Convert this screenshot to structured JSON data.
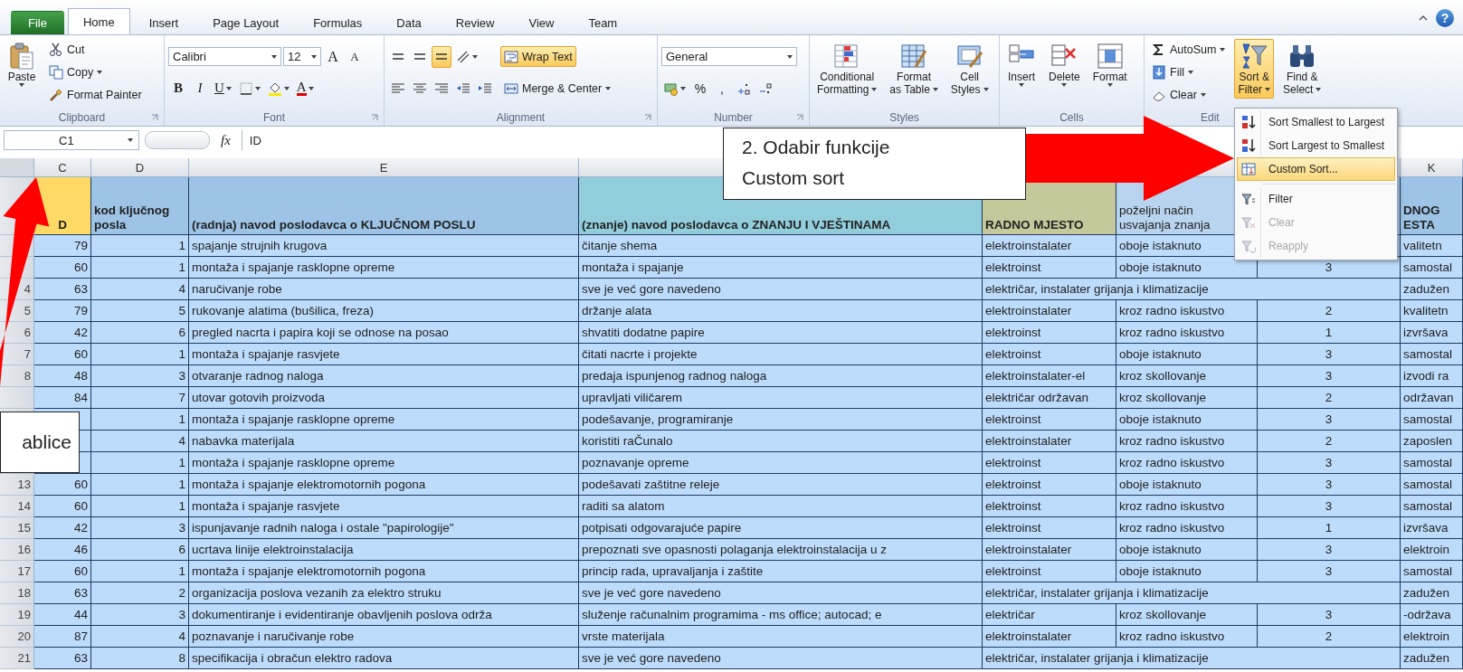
{
  "ribbon": {
    "tabs": [
      {
        "label": "File",
        "kind": "file",
        "selected": false
      },
      {
        "label": "Home",
        "kind": "tab",
        "selected": true
      },
      {
        "label": "Insert",
        "kind": "tab",
        "selected": false
      },
      {
        "label": "Page Layout",
        "kind": "tab",
        "selected": false
      },
      {
        "label": "Formulas",
        "kind": "tab",
        "selected": false
      },
      {
        "label": "Data",
        "kind": "tab",
        "selected": false
      },
      {
        "label": "Review",
        "kind": "tab",
        "selected": false
      },
      {
        "label": "View",
        "kind": "tab",
        "selected": false
      },
      {
        "label": "Team",
        "kind": "tab",
        "selected": false
      }
    ],
    "help": "?",
    "groups": [
      {
        "label": "Clipboard",
        "launcher": true,
        "items": [
          {
            "kind": "large",
            "lines": [
              "Paste"
            ],
            "caret": true
          },
          {
            "kind": "stack",
            "rows": [
              {
                "controls": [
                  {
                    "kind": "small",
                    "label": "Cut"
                  }
                ]
              },
              {
                "controls": [
                  {
                    "kind": "small",
                    "label": "Copy",
                    "caret": true
                  }
                ]
              },
              {
                "controls": [
                  {
                    "kind": "small",
                    "label": "Format Painter"
                  }
                ]
              }
            ]
          }
        ]
      },
      {
        "label": "Font",
        "launcher": true,
        "items": [
          {
            "kind": "stack",
            "rows": [
              {
                "controls": [
                  {
                    "kind": "fontbox",
                    "value": "Calibri"
                  },
                  {
                    "kind": "sizebox",
                    "value": "12"
                  },
                  {
                    "kind": "grow",
                    "text": "A"
                  },
                  {
                    "kind": "shrink",
                    "text": "A"
                  }
                ]
              },
              {
                "controls": [
                  {
                    "kind": "bold",
                    "text": "B"
                  },
                  {
                    "kind": "italic",
                    "text": "I"
                  },
                  {
                    "kind": "underline",
                    "text": "U",
                    "caret": true
                  },
                  {
                    "kind": "icon",
                    "caret": true
                  },
                  {
                    "kind": "icon",
                    "caret": true
                  },
                  {
                    "kind": "fontcolor",
                    "text": "A",
                    "caret": true
                  }
                ]
              }
            ]
          }
        ]
      },
      {
        "label": "Alignment",
        "launcher": true,
        "items": [
          {
            "kind": "stack",
            "rows": [
              {
                "controls": [
                  {
                    "kind": "icon",
                    "on": false
                  },
                  {
                    "kind": "icon",
                    "on": false
                  },
                  {
                    "kind": "icon",
                    "on": true
                  },
                  {
                    "kind": "icon",
                    "caret": true
                  }
                ]
              },
              {
                "controls": [
                  {
                    "kind": "icon",
                    "on": false
                  },
                  {
                    "kind": "icon",
                    "on": false
                  },
                  {
                    "kind": "icon",
                    "on": false
                  },
                  {
                    "kind": "icon"
                  },
                  {
                    "kind": "icon"
                  }
                ]
              }
            ]
          },
          {
            "kind": "stack",
            "rows": [
              {
                "controls": [
                  {
                    "kind": "small",
                    "label": "Wrap Text",
                    "on": true
                  }
                ]
              },
              {
                "controls": [
                  {
                    "kind": "small",
                    "label": "Merge & Center",
                    "caret": true,
                    "on": false
                  }
                ]
              }
            ]
          }
        ]
      },
      {
        "label": "Number",
        "launcher": true,
        "items": [
          {
            "kind": "stack",
            "rows": [
              {
                "controls": [
                  {
                    "kind": "formatbox",
                    "value": "General"
                  }
                ]
              },
              {
                "controls": [
                  {
                    "kind": "icon",
                    "caret": true
                  },
                  {
                    "kind": "symbol",
                    "text": "%"
                  },
                  {
                    "kind": "symbol",
                    "text": ","
                  },
                  {
                    "kind": "icon"
                  },
                  {
                    "kind": "icon"
                  }
                ]
              }
            ]
          }
        ]
      },
      {
        "label": "Styles",
        "items": [
          {
            "kind": "large",
            "lines": [
              "Conditional",
              "Formatting"
            ],
            "caret": true
          },
          {
            "kind": "large",
            "lines": [
              "Format",
              "as Table"
            ],
            "caret": true
          },
          {
            "kind": "large",
            "lines": [
              "Cell",
              "Styles"
            ],
            "caret": true
          }
        ]
      },
      {
        "label": "Cells",
        "items": [
          {
            "kind": "large",
            "lines": [
              "Insert"
            ],
            "caret": true
          },
          {
            "kind": "large",
            "lines": [
              "Delete"
            ],
            "caret": true
          },
          {
            "kind": "large",
            "lines": [
              "Format"
            ],
            "caret": true
          }
        ]
      },
      {
        "label": "Edit",
        "items": [
          {
            "kind": "stack",
            "rows": [
              {
                "controls": [
                  {
                    "kind": "small",
                    "label": "AutoSum",
                    "caret": true
                  }
                ]
              },
              {
                "controls": [
                  {
                    "kind": "small",
                    "label": "Fill",
                    "caret": true
                  }
                ]
              },
              {
                "controls": [
                  {
                    "kind": "small",
                    "label": "Clear",
                    "caret": true
                  }
                ]
              }
            ]
          },
          {
            "kind": "large",
            "lines": [
              "Sort &",
              "Filter"
            ],
            "caret": true,
            "on": true
          },
          {
            "kind": "large",
            "lines": [
              "Find &",
              "Select"
            ],
            "caret": true,
            "on": false
          }
        ]
      }
    ]
  },
  "formula_bar": {
    "name_box": "C1",
    "fx": "fx",
    "formula": "ID"
  },
  "sheet": {
    "columns": [
      "C",
      "D",
      "E",
      "K"
    ],
    "header_row": [
      {
        "text": "D",
        "color": "#ffd966",
        "bold": true
      },
      {
        "text": "kod ključnog posla",
        "color": "#9dc3e6",
        "bold": true
      },
      {
        "text": "(radnja) navod poslodavca o KLJUČNOM POSLU",
        "color": "#9dc3e6",
        "bold": true
      },
      {
        "text": "(znanje) navod poslodavca o ZNANJU I VJEŠTINAMA",
        "color": "#92cddc",
        "bold": true
      },
      {
        "text": "RADNO MJESTO",
        "color": "#c4c89b",
        "bold": true
      },
      {
        "text": "poželjni način usvajanja znanja",
        "color": "#b8d4ee",
        "bold": false
      },
      {
        "text": "DNOG ESTA",
        "color": "#9dc3e6",
        "bold": true
      }
    ],
    "rows": [
      {
        "kind": "normal",
        "c": "79",
        "d": "1",
        "e": "spajanje strujnih krugova",
        "f": "čitanje shema",
        "g": "elektroinstalater",
        "h": "oboje istaknuto",
        "k": "valitetn"
      },
      {
        "kind": "normal",
        "c": "60",
        "d": "1",
        "e": "montaža i spajanje rasklopne opreme",
        "f": "montaža i spajanje",
        "g": "elektroinst",
        "h": "oboje istaknuto",
        "i": "3",
        "k": "samostal"
      },
      {
        "kind": "overflow",
        "num": "4",
        "c": "63",
        "d": "4",
        "e": "naručivanje robe",
        "f": "sve je već gore navedeno",
        "g": "električar, instalater grijanja i klimatizacije",
        "k": "zadužen"
      },
      {
        "kind": "normal",
        "num": "5",
        "c": "79",
        "d": "5",
        "e": "rukovanje alatima (bušilica, freza)",
        "f": "držanje alata",
        "g": "elektroinstalater",
        "h": "kroz radno iskustvo",
        "i": "2",
        "k": "kvalitetn"
      },
      {
        "kind": "normal",
        "num": "6",
        "c": "42",
        "d": "6",
        "e": "pregled nacrta i papira koji se odnose na posao",
        "f": "shvatiti dodatne papire",
        "g": "elektroinst",
        "h": "kroz radno iskustvo",
        "i": "1",
        "k": "izvršava"
      },
      {
        "kind": "normal",
        "num": "7",
        "c": "60",
        "d": "1",
        "e": "montaža i spajanje rasvjete",
        "f": "čitati nacrte i projekte",
        "g": "elektroinst",
        "h": "oboje istaknuto",
        "i": "3",
        "k": "samostal"
      },
      {
        "kind": "normal",
        "num": "8",
        "c": "48",
        "d": "3",
        "e": "otvaranje radnog naloga",
        "f": "predaja ispunjenog radnog naloga",
        "g": "elektroinstalater-el",
        "h": "kroz skollovanje",
        "i": "3",
        "k": "izvodi ra"
      },
      {
        "kind": "normal",
        "c": "84",
        "d": "7",
        "e": "utovar gotovih proizvoda",
        "f": "upravljati viličarem",
        "g": "električar održavan",
        "h": "kroz skollovanje",
        "i": "2",
        "k": "održavan"
      },
      {
        "kind": "normal",
        "d": "1",
        "e": "montaža i spajanje rasklopne opreme",
        "f": "podešavanje, programiranje",
        "g": "elektroinst",
        "h": "oboje istaknuto",
        "i": "3",
        "k": "samostal"
      },
      {
        "kind": "normal",
        "d": "4",
        "e": "nabavka materijala",
        "f": "koristiti raČunalo",
        "g": "elektroinstalater",
        "h": "kroz radno iskustvo",
        "i": "2",
        "k": "zaposlen"
      },
      {
        "kind": "normal",
        "d": "1",
        "e": "montaža i spajanje rasklopne opreme",
        "f": "poznavanje opreme",
        "g": "elektroinst",
        "h": "kroz radno iskustvo",
        "i": "3",
        "k": "samostal"
      },
      {
        "kind": "normal",
        "num": "13",
        "c": "60",
        "d": "1",
        "e": "montaža i spajanje elektromotornih pogona",
        "f": "podešavati zaštitne releje",
        "g": "elektroinst",
        "h": "oboje istaknuto",
        "i": "3",
        "k": "samostal"
      },
      {
        "kind": "normal",
        "num": "14",
        "c": "60",
        "d": "1",
        "e": "montaža i spajanje rasvjete",
        "f": "raditi sa alatom",
        "g": "elektroinst",
        "h": "kroz radno iskustvo",
        "i": "3",
        "k": "samostal"
      },
      {
        "kind": "normal",
        "num": "15",
        "c": "42",
        "d": "3",
        "e": "ispunjavanje radnih naloga i ostale \"papirologije\"",
        "f": "potpisati odgovarajuće papire",
        "g": "elektroinst",
        "h": "kroz radno iskustvo",
        "i": "1",
        "k": "izvršava"
      },
      {
        "kind": "normal",
        "num": "16",
        "c": "46",
        "d": "6",
        "e": "ucrtava linije elektroinstalacija",
        "f": "prepoznati sve opasnosti polaganja elektroinstalacija u z",
        "g": "elektroinstalater",
        "h": "oboje istaknuto",
        "i": "3",
        "k": "elektroin"
      },
      {
        "kind": "normal",
        "num": "17",
        "c": "60",
        "d": "1",
        "e": "montaža i spajanje elektromotornih pogona",
        "f": "princip rada, upravaljanja i zaštite",
        "g": "elektroinst",
        "h": "oboje istaknuto",
        "i": "3",
        "k": "samostal"
      },
      {
        "kind": "overflow",
        "num": "18",
        "c": "63",
        "d": "2",
        "e": "organizacija poslova vezanih za elektro struku",
        "f": "sve je već gore navedeno",
        "g": "električar, instalater grijanja i klimatizacije",
        "k": "zadužen"
      },
      {
        "kind": "normal",
        "num": "19",
        "c": "44",
        "d": "3",
        "e": "dokumentiranje i evidentiranje obavljenih poslova održa",
        "f": "služenje računalnim programima - ms office; autocad; e",
        "g": "električar",
        "h": "kroz skollovanje",
        "i": "3",
        "k": "-održava"
      },
      {
        "kind": "normal",
        "num": "20",
        "c": "87",
        "d": "4",
        "e": "poznavanje i naručivanje robe",
        "f": "vrste materijala",
        "g": "elektroinstalater",
        "h": "kroz radno iskustvo",
        "i": "2",
        "k": "elektroin"
      },
      {
        "kind": "overflow",
        "num": "21",
        "c": "63",
        "d": "8",
        "e": "specifikacija i obračun elektro radova",
        "f": "sve je već gore navedeno",
        "g": "električar, instalater grijanja i klimatizacije",
        "k": "zadužen"
      }
    ]
  },
  "sort_menu": {
    "sections": [
      [
        {
          "label": "Sort Smallest to Largest",
          "selected": false,
          "disabled": false
        },
        {
          "label": "Sort Largest to Smallest",
          "selected": false,
          "disabled": false
        },
        {
          "label": "Custom Sort...",
          "selected": true,
          "disabled": false
        }
      ],
      [
        {
          "label": "Filter",
          "selected": false,
          "disabled": false
        },
        {
          "label": "Clear",
          "selected": false,
          "disabled": true
        },
        {
          "label": "Reapply",
          "selected": false,
          "disabled": true
        }
      ]
    ]
  },
  "callouts": [
    {
      "kind": "main",
      "lines": [
        "2. Odabir funkcije",
        "Custom sort"
      ]
    },
    {
      "kind": "edge",
      "lines": [
        "ablice"
      ]
    }
  ]
}
